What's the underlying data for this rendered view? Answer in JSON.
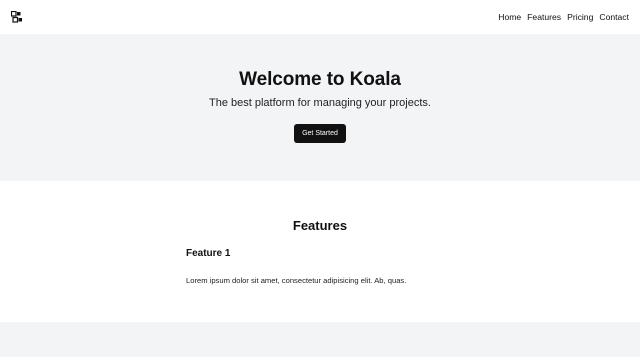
{
  "header": {
    "logo_icon": "koala-logo-icon",
    "nav": [
      {
        "label": "Home"
      },
      {
        "label": "Features"
      },
      {
        "label": "Pricing"
      },
      {
        "label": "Contact"
      }
    ]
  },
  "hero": {
    "title": "Welcome to Koala",
    "subtitle": "The best platform for managing your projects.",
    "cta_label": "Get Started",
    "background_color": "#f3f4f6",
    "cta_color": "#111111"
  },
  "features": {
    "title": "Features",
    "items": [
      {
        "name": "Feature 1",
        "description": "Lorem ipsum dolor sit amet, consectetur adipisicing elit. Ab, quas."
      }
    ]
  }
}
